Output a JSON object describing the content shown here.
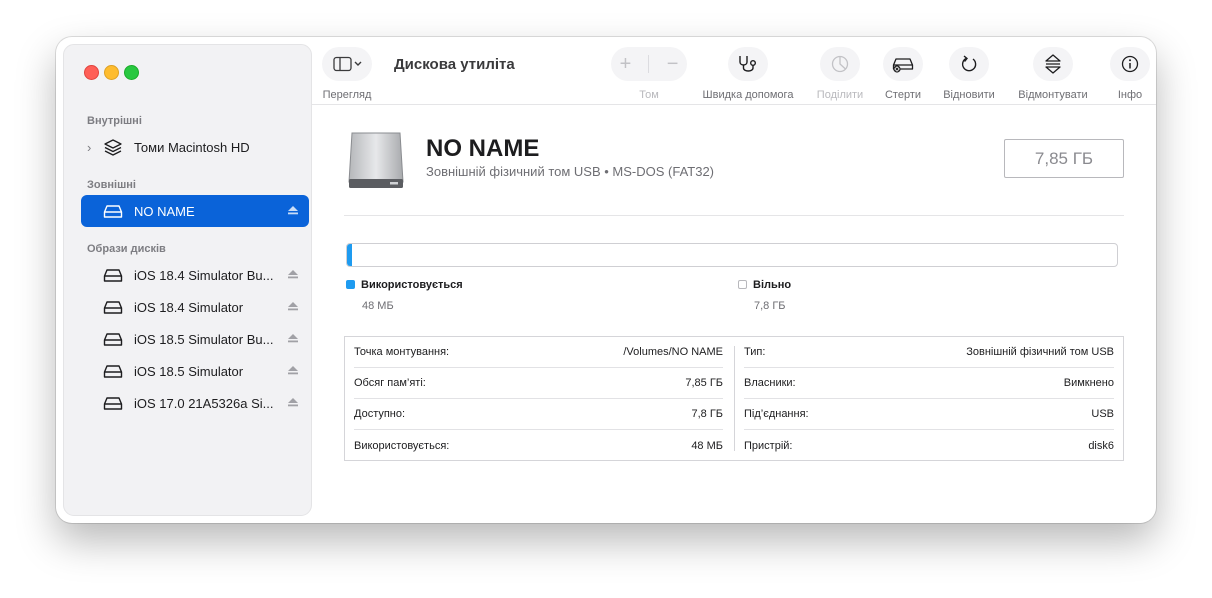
{
  "app": {
    "title": "Дискова утиліта"
  },
  "sidebar": {
    "sections": [
      {
        "label": "Внутрішні"
      },
      {
        "label": "Зовнішні"
      },
      {
        "label": "Образи дисків"
      }
    ],
    "internal": [
      {
        "label": "Томи Macintosh HD",
        "icon": "layers-icon"
      }
    ],
    "external": [
      {
        "label": "NO NAME",
        "icon": "drive-icon",
        "selected": true
      }
    ],
    "images": [
      {
        "label": "iOS 18.4 Simulator Bu..."
      },
      {
        "label": "iOS 18.4 Simulator"
      },
      {
        "label": "iOS 18.5 Simulator Bu..."
      },
      {
        "label": "iOS 18.5 Simulator"
      },
      {
        "label": "iOS 17.0 21A5326a Si..."
      }
    ]
  },
  "toolbar": {
    "view_label": "Перегляд",
    "volume_label": "Том",
    "firstaid_label": "Швидка допомога",
    "partition_label": "Поділити",
    "erase_label": "Стерти",
    "restore_label": "Відновити",
    "unmount_label": "Відмонтувати",
    "info_label": "Інфо"
  },
  "disk": {
    "name": "NO NAME",
    "subtitle": "Зовнішній фізичний том USB • MS-DOS (FAT32)",
    "capacity": "7,85 ГБ"
  },
  "usage": {
    "used_fraction": 0.006,
    "used_label": "Використовується",
    "used_value": "48 МБ",
    "free_label": "Вільно",
    "free_value": "7,8 ГБ",
    "used_color": "#1e9bf0"
  },
  "info": {
    "left": [
      {
        "key": "Точка монтування:",
        "value": "/Volumes/NO NAME"
      },
      {
        "key": "Обсяг пам’яті:",
        "value": "7,85 ГБ"
      },
      {
        "key": "Доступно:",
        "value": "7,8 ГБ"
      },
      {
        "key": "Використовується:",
        "value": "48 МБ"
      }
    ],
    "right": [
      {
        "key": "Тип:",
        "value": "Зовнішній фізичний том USB"
      },
      {
        "key": "Власники:",
        "value": "Вимкнено"
      },
      {
        "key": "Під’єднання:",
        "value": "USB"
      },
      {
        "key": "Пристрій:",
        "value": "disk6"
      }
    ]
  }
}
